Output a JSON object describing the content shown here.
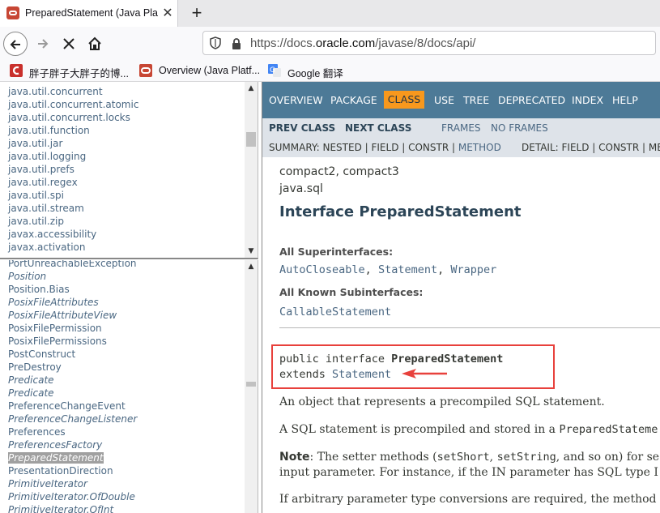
{
  "browser": {
    "tab_title": "PreparedStatement (Java Pla",
    "tab_close": "✕",
    "new_tab": "+",
    "url_prefix": "https://docs.",
    "url_domain": "oracle.com",
    "url_path": "/javase/8/docs/api/",
    "bookmarks": [
      {
        "label": "胖子胖子大胖子的博...",
        "icon": "csdn-icon"
      },
      {
        "label": "Overview (Java Platf...",
        "icon": "oracle-icon"
      },
      {
        "label": "Google 翻译",
        "icon": "google-translate-icon"
      }
    ]
  },
  "package_list": [
    "java.util.concurrent",
    "java.util.concurrent.atomic",
    "java.util.concurrent.locks",
    "java.util.function",
    "java.util.jar",
    "java.util.logging",
    "java.util.prefs",
    "java.util.regex",
    "java.util.spi",
    "java.util.stream",
    "java.util.zip",
    "javax.accessibility",
    "javax.activation"
  ],
  "class_list": [
    {
      "label": "PortUnreachableException",
      "italic": false
    },
    {
      "label": "Position",
      "italic": true
    },
    {
      "label": "Position.Bias",
      "italic": false
    },
    {
      "label": "PosixFileAttributes",
      "italic": true
    },
    {
      "label": "PosixFileAttributeView",
      "italic": true
    },
    {
      "label": "PosixFilePermission",
      "italic": false
    },
    {
      "label": "PosixFilePermissions",
      "italic": false
    },
    {
      "label": "PostConstruct",
      "italic": false
    },
    {
      "label": "PreDestroy",
      "italic": false
    },
    {
      "label": "Predicate",
      "italic": true
    },
    {
      "label": "Predicate",
      "italic": true
    },
    {
      "label": "PreferenceChangeEvent",
      "italic": false
    },
    {
      "label": "PreferenceChangeListener",
      "italic": true
    },
    {
      "label": "Preferences",
      "italic": false
    },
    {
      "label": "PreferencesFactory",
      "italic": true
    },
    {
      "label": "PreparedStatement",
      "italic": true,
      "selected": true
    },
    {
      "label": "PresentationDirection",
      "italic": false
    },
    {
      "label": "PrimitiveIterator",
      "italic": true
    },
    {
      "label": "PrimitiveIterator.OfDouble",
      "italic": true
    },
    {
      "label": "PrimitiveIterator.OfInt",
      "italic": true
    }
  ],
  "topnav": {
    "overview": "OVERVIEW",
    "package": "PACKAGE",
    "class": "CLASS",
    "use": "USE",
    "tree": "TREE",
    "deprecated": "DEPRECATED",
    "index": "INDEX",
    "help": "HELP"
  },
  "subnav": {
    "prev_class": "PREV CLASS",
    "next_class": "NEXT CLASS",
    "frames": "FRAMES",
    "no_frames": "NO FRAMES",
    "summary_prefix": "SUMMARY: NESTED | FIELD | CONSTR | ",
    "summary_method": "METHOD",
    "detail_prefix": "DETAIL: FIELD | CONSTR | ME"
  },
  "content": {
    "profiles": "compact2, compact3",
    "package": "java.sql",
    "title": "Interface PreparedStatement",
    "superinterfaces_label": "All Superinterfaces:",
    "superinterfaces": [
      "AutoCloseable",
      "Statement",
      "Wrapper"
    ],
    "subinterfaces_label": "All Known Subinterfaces:",
    "subinterfaces": "CallableStatement",
    "decl_line1_prefix": "public interface ",
    "decl_line1_name": "PreparedStatement",
    "decl_line2_prefix": "extends ",
    "decl_line2_link": "Statement",
    "para1": "An object that represents a precompiled SQL statement.",
    "para2_prefix": "A SQL statement is precompiled and stored in a ",
    "para2_code": "PreparedStateme",
    "note_label": "Note",
    "note_text1": ": The setter methods (",
    "note_code1": "setShort",
    "note_text2": ", ",
    "note_code2": "setString",
    "note_text3": ", and so on) for se",
    "note_line2": "input parameter. For instance, if the IN parameter has SQL type I",
    "para4": "If arbitrary parameter type conversions are required, the method"
  },
  "colors": {
    "topnav_bg": "#4d7a97",
    "class_highlight": "#f8981d",
    "subnav_bg": "#dee3e9",
    "link": "#4a6782",
    "annotation_red": "#e8413c"
  }
}
